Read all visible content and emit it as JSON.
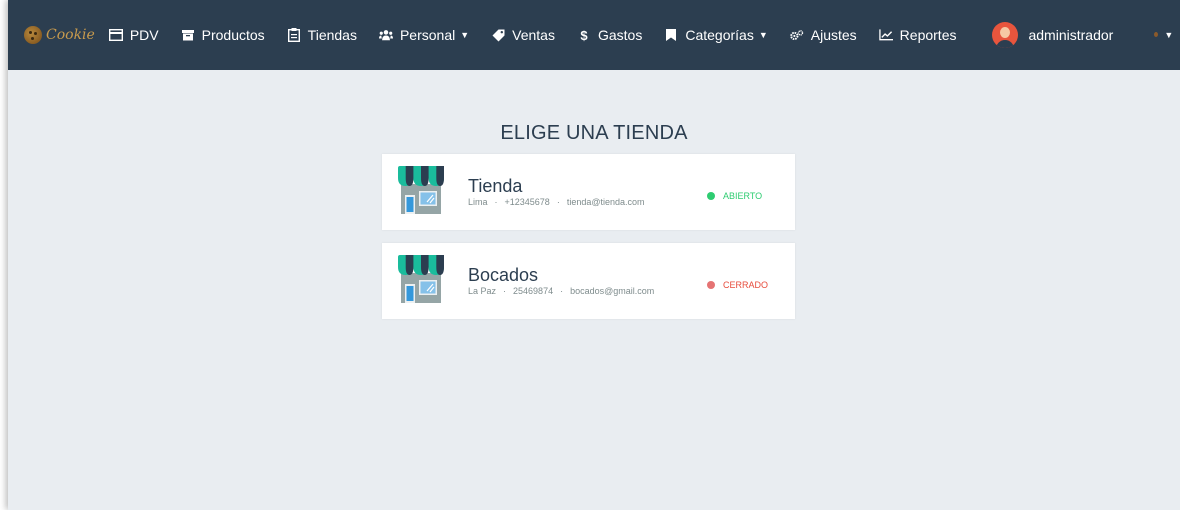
{
  "brand": {
    "name": "Cookie"
  },
  "nav": {
    "items": [
      {
        "label": "PDV",
        "icon": "credit-card-icon"
      },
      {
        "label": "Productos",
        "icon": "archive-icon"
      },
      {
        "label": "Tiendas",
        "icon": "clipboard-icon"
      },
      {
        "label": "Personal",
        "icon": "users-icon",
        "dropdown": true
      },
      {
        "label": "Ventas",
        "icon": "tag-icon"
      },
      {
        "label": "Gastos",
        "icon": "dollar-icon"
      },
      {
        "label": "Categorías",
        "icon": "bookmark-icon",
        "dropdown": true
      },
      {
        "label": "Ajustes",
        "icon": "cogs-icon"
      },
      {
        "label": "Reportes",
        "icon": "line-chart-icon"
      }
    ],
    "user": "administrador",
    "language_flag": "mexico-flag-icon"
  },
  "page": {
    "title": "ELIGE UNA TIENDA"
  },
  "stores": [
    {
      "name": "Tienda",
      "city": "Lima",
      "phone": "+12345678",
      "email": "tienda@tienda.com",
      "status": "ABIERTO",
      "status_color": "#2ecc71"
    },
    {
      "name": "Bocados",
      "city": "La Paz",
      "phone": "25469874",
      "email": "bocados@gmail.com",
      "status": "CERRADO",
      "status_color": "#e74c3c"
    }
  ],
  "colors": {
    "navbar": "#2c3e50",
    "background": "#e9edf1",
    "open": "#2ecc71",
    "closed": "#e74c3c"
  }
}
